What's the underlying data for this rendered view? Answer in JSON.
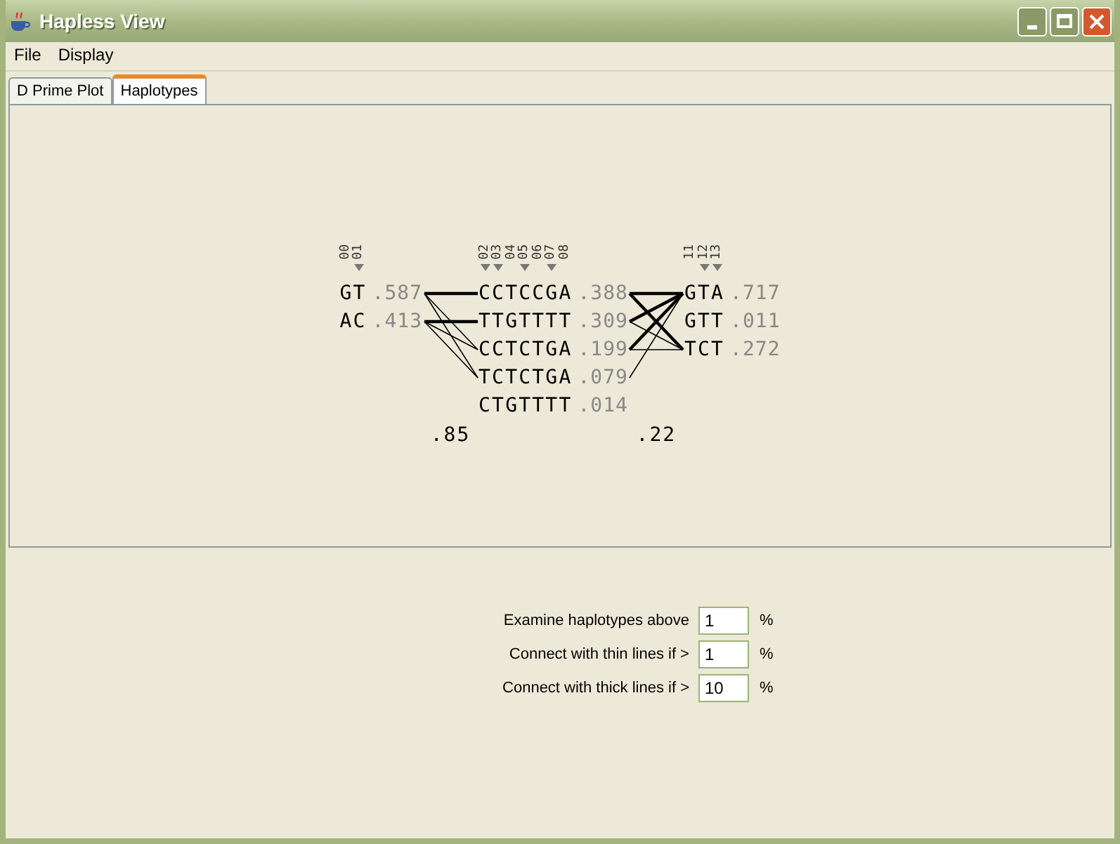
{
  "window": {
    "title": "Hapless View"
  },
  "menu": [
    "File",
    "Display"
  ],
  "tabs": [
    {
      "label": "D Prime Plot",
      "selected": false
    },
    {
      "label": "Haplotypes",
      "selected": true
    }
  ],
  "blocks": [
    {
      "markers": [
        {
          "label": "00",
          "tagged": false
        },
        {
          "label": "01",
          "tagged": true
        }
      ],
      "haplotypes": [
        {
          "seq": "GT",
          "freq": ".587"
        },
        {
          "seq": "AC",
          "freq": ".413"
        }
      ]
    },
    {
      "markers": [
        {
          "label": "02",
          "tagged": true
        },
        {
          "label": "03",
          "tagged": true
        },
        {
          "label": "04",
          "tagged": false
        },
        {
          "label": "05",
          "tagged": true
        },
        {
          "label": "06",
          "tagged": false
        },
        {
          "label": "07",
          "tagged": true
        },
        {
          "label": "08",
          "tagged": false
        }
      ],
      "haplotypes": [
        {
          "seq": "CCTCCGA",
          "freq": ".388"
        },
        {
          "seq": "TTGTTTT",
          "freq": ".309"
        },
        {
          "seq": "CCTCTGA",
          "freq": ".199"
        },
        {
          "seq": "TCTCTGA",
          "freq": ".079"
        },
        {
          "seq": "CTGTTTT",
          "freq": ".014"
        }
      ]
    },
    {
      "markers": [
        {
          "label": "11",
          "tagged": false
        },
        {
          "label": "12",
          "tagged": true
        },
        {
          "label": "13",
          "tagged": true
        }
      ],
      "haplotypes": [
        {
          "seq": "GTA",
          "freq": ".717"
        },
        {
          "seq": "GTT",
          "freq": ".011"
        },
        {
          "seq": "TCT",
          "freq": ".272"
        }
      ]
    }
  ],
  "links": [
    {
      "value": ".85"
    },
    {
      "value": ".22"
    }
  ],
  "settings": [
    {
      "label": "Examine haplotypes above",
      "value": "1",
      "unit": "%"
    },
    {
      "label": "Connect with thin lines if >",
      "value": "1",
      "unit": "%"
    },
    {
      "label": "Connect with thick lines if >",
      "value": "10",
      "unit": "%"
    }
  ]
}
